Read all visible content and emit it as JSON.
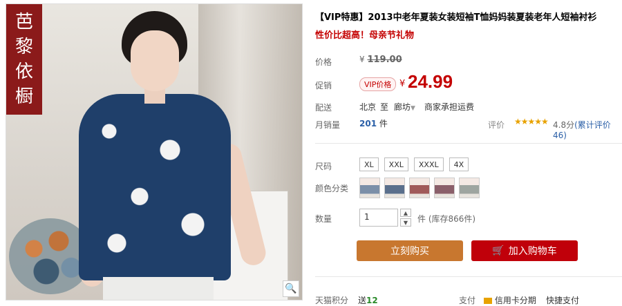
{
  "product": {
    "brand_text": [
      "芭",
      "黎",
      "依",
      "橱"
    ],
    "title": "【VIP特惠】2013中老年夏装女装短袖T恤妈妈装夏装老年人短袖衬衫",
    "subtitle": "性价比超高！母亲节礼物"
  },
  "price": {
    "label_price": "价格",
    "currency": "¥",
    "original": "119.00",
    "label_promo": "促销",
    "vip_badge": "VIP价格",
    "current": "24.99"
  },
  "shipping": {
    "label": "配送",
    "from": "北京",
    "to_word": "至",
    "dest": "廊坊",
    "fee": "商家承担运费"
  },
  "sales": {
    "label": "月销量",
    "count": "201",
    "unit": "件",
    "rating_label": "评价",
    "stars": "★★★★★",
    "score": "4.8分",
    "reviews": "(累计评价46)"
  },
  "sizes": {
    "label": "尺码",
    "options": [
      "XL",
      "XXL",
      "XXXL",
      "4X"
    ]
  },
  "colors": {
    "label": "颜色分类"
  },
  "quantity": {
    "label": "数量",
    "value": "1",
    "up": "▲",
    "down": "▼",
    "unit_stock": "件 (库存866件)"
  },
  "actions": {
    "buy": "立刻购买",
    "cart": "加入购物车"
  },
  "footer": {
    "tmall_points": "天猫积分",
    "points_prefix": "送",
    "points": "12",
    "pay": "支付",
    "installment": "信用卡分期",
    "express": "快捷支付"
  }
}
